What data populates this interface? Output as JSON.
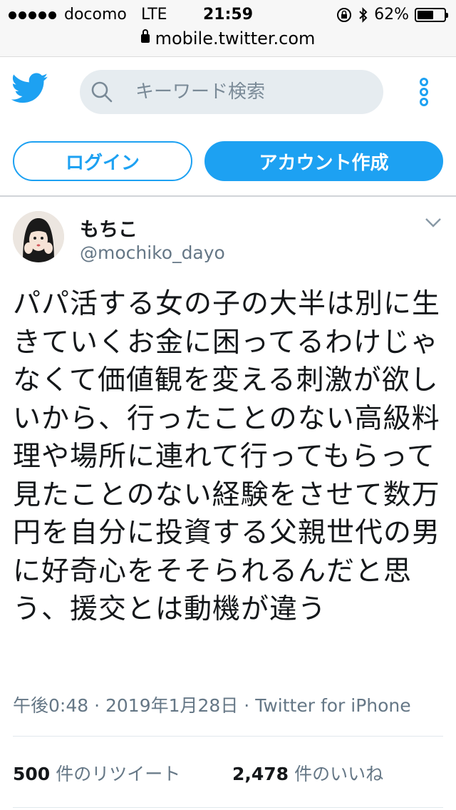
{
  "status_bar": {
    "carrier": "docomo",
    "network": "LTE",
    "time": "21:59",
    "battery_percent": "62%",
    "battery_level": 0.62
  },
  "browser": {
    "url": "mobile.twitter.com"
  },
  "header": {
    "logo_icon": "twitter-bird-icon",
    "search_placeholder": "キーワード検索",
    "more_icon": "more-vertical-icon",
    "login_label": "ログイン",
    "signup_label": "アカウント作成"
  },
  "tweet": {
    "display_name": "もちこ",
    "handle": "@mochiko_dayo",
    "text": "パパ活する女の子の大半は別に生きていくお金に困ってるわけじゃなくて価値観を変える刺激が欲しいから、行ったことのない高級料理や場所に連れて行ってもらって見たことのない経験をさせて数万円を自分に投資する父親世代の男に好奇心をそそられるんだと思う、援交とは動機が違う",
    "time": "午後0:48",
    "date": "2019年1月28日",
    "source": "Twitter for iPhone",
    "retweet_count": "500",
    "retweet_label": "件のリツイート",
    "like_count": "2,478",
    "like_label": "件のいいね"
  },
  "colors": {
    "brand": "#1da1f2",
    "secondary_text": "#657786",
    "search_bg": "#e6ecf0"
  }
}
